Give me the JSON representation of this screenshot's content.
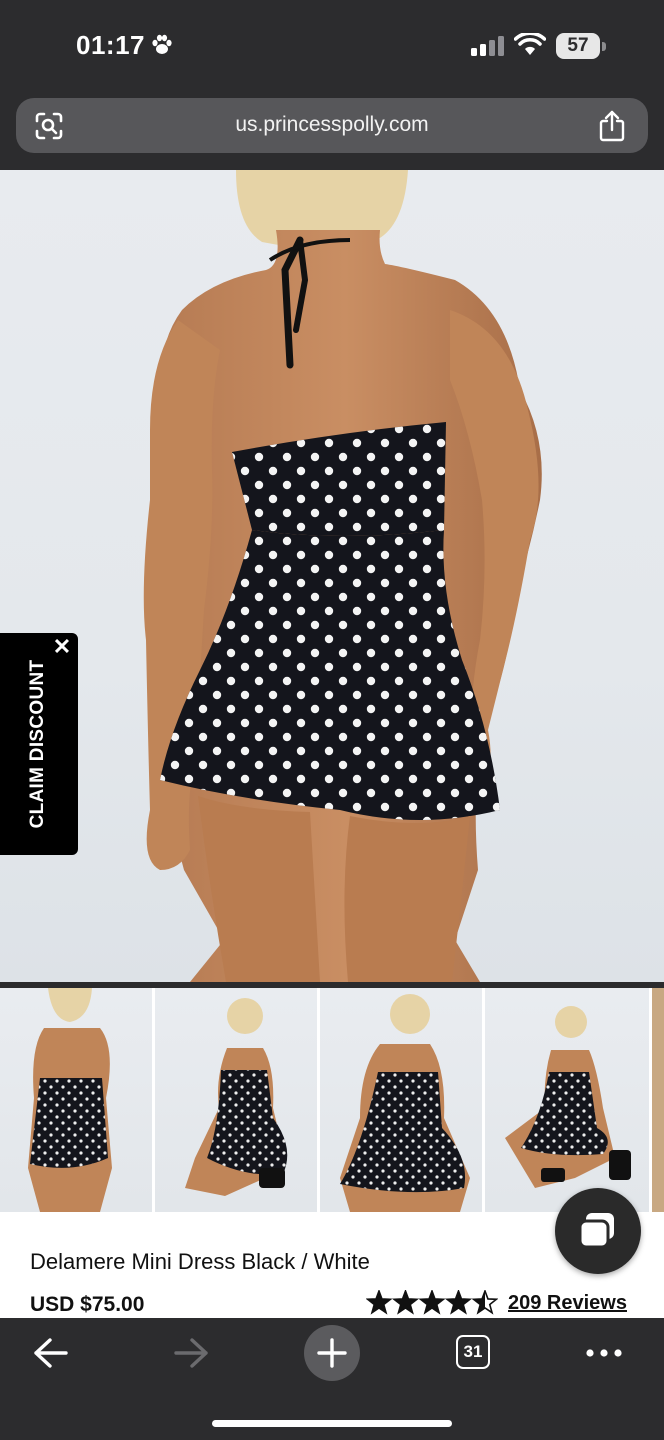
{
  "status_bar": {
    "time": "01:17",
    "battery": "57",
    "icons": [
      "paw-icon",
      "signal-icon",
      "wifi-icon",
      "battery-icon"
    ]
  },
  "browser": {
    "url": "us.princesspolly.com",
    "icons": [
      "lens-icon",
      "share-icon"
    ]
  },
  "promo": {
    "claim_label": "CLAIM DISCOUNT",
    "close_glyph": "✕"
  },
  "product": {
    "title": "Delamere Mini Dress Black / White",
    "price": "USD  $75.00",
    "rating": 4.5,
    "rating_max": 5,
    "reviews": "209 Reviews",
    "thumbnail_count": 5
  },
  "toolbar": {
    "tab_count": "31",
    "icons": [
      "back-icon",
      "forward-icon",
      "new-tab-icon",
      "tabs-icon",
      "more-icon"
    ]
  },
  "colors": {
    "chrome": "#2c2c2e",
    "dress": "#14151c",
    "dots": "#f4f4f4",
    "accent": "#000000"
  }
}
